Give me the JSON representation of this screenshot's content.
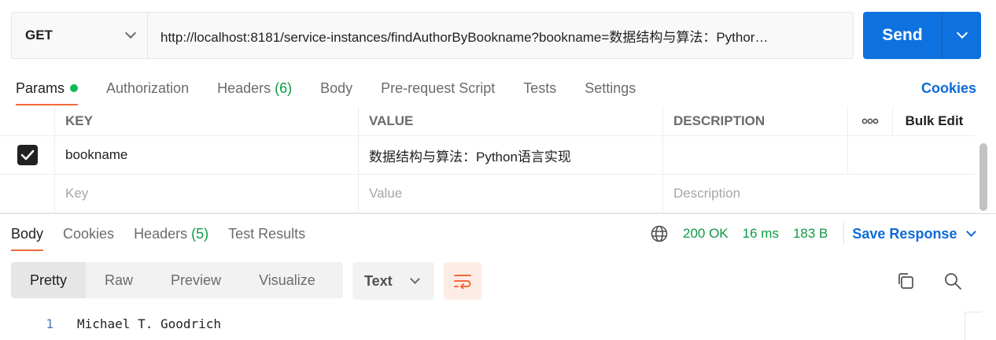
{
  "request": {
    "method": "GET",
    "url": "http://localhost:8181/service-instances/findAuthorByBookname?bookname=数据结构与算法：Pythor…",
    "send_label": "Send"
  },
  "request_tabs": [
    {
      "label": "Params",
      "active": true
    },
    {
      "label": "Authorization"
    },
    {
      "label": "Headers",
      "count": "(6)"
    },
    {
      "label": "Body"
    },
    {
      "label": "Pre-request Script"
    },
    {
      "label": "Tests"
    },
    {
      "label": "Settings"
    }
  ],
  "cookies_label": "Cookies",
  "params": {
    "headers": {
      "key": "KEY",
      "value": "VALUE",
      "description": "DESCRIPTION",
      "more": "ooo",
      "bulk_edit": "Bulk Edit"
    },
    "rows": [
      {
        "checked": true,
        "key": "bookname",
        "value": "数据结构与算法：Python语言实现",
        "description": ""
      }
    ],
    "placeholders": {
      "key": "Key",
      "value": "Value",
      "description": "Description"
    }
  },
  "response_tabs": [
    {
      "label": "Body",
      "active": true
    },
    {
      "label": "Cookies"
    },
    {
      "label": "Headers",
      "count": "(5)"
    },
    {
      "label": "Test Results"
    }
  ],
  "response_meta": {
    "status": "200 OK",
    "time": "16 ms",
    "size": "183 B",
    "save_label": "Save Response"
  },
  "view_modes": [
    "Pretty",
    "Raw",
    "Preview",
    "Visualize"
  ],
  "format": "Text",
  "body_lines": [
    {
      "number": "1",
      "text": "Michael T. Goodrich"
    }
  ],
  "colors": {
    "accent": "#f26b3a",
    "send": "#0e71e0",
    "link": "#0d6ad6",
    "success": "#0c9a43"
  }
}
